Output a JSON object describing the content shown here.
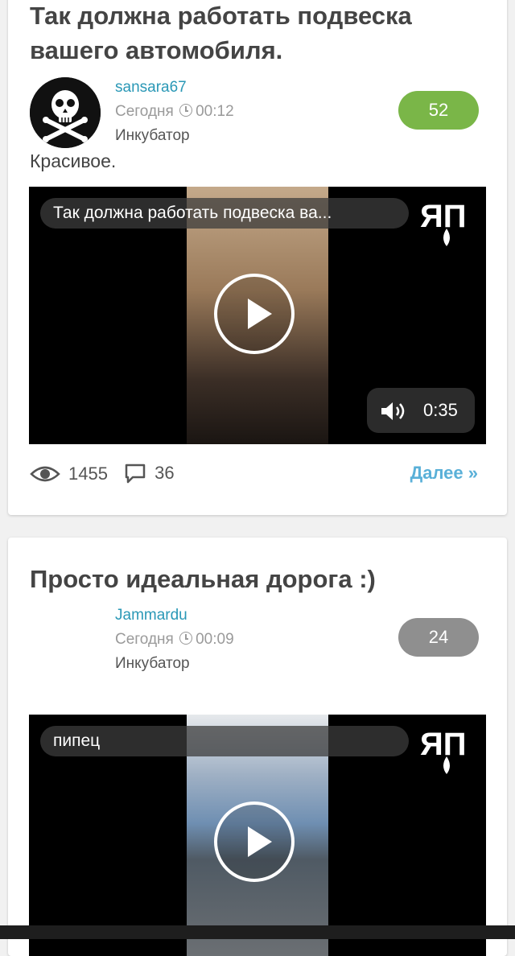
{
  "posts": [
    {
      "title": "Так должна работать подвеска вашего автомобиля.",
      "author": "sansara67",
      "date": "Сегодня",
      "time": "00:12",
      "category": "Инкубатор",
      "rating": "52",
      "rating_color": "#7ab648",
      "avatar_icon": "skull-crossbones-icon",
      "text": "Красивое.",
      "video": {
        "title": "Так должна работать подвеска ва...",
        "logo": "ЯП",
        "duration": "0:35"
      },
      "views": "1455",
      "comments": "36",
      "more_label": "Далее »"
    },
    {
      "title": "Просто идеальная дорога :)",
      "author": "Jammardu",
      "date": "Сегодня",
      "time": "00:09",
      "category": "Инкубатор",
      "rating": "24",
      "rating_color": "#8f8f8f",
      "video": {
        "title": "пипец",
        "logo": "ЯП"
      }
    }
  ]
}
